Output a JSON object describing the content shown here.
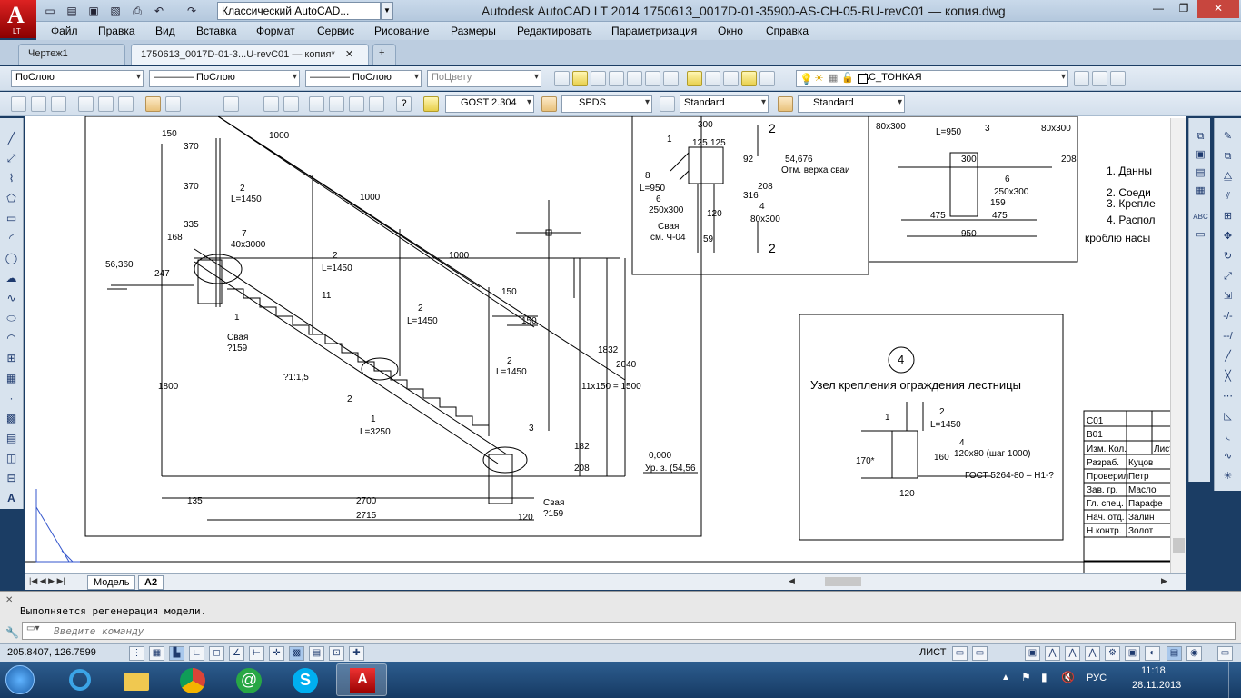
{
  "app": {
    "logo_letter": "A",
    "logo_sub": "LT",
    "workspace": "Классический AutoCAD...",
    "window_title": "Autodesk AutoCAD LT 2014    1750613_0017D-01-35900-AS-CH-05-RU-revC01 — копия.dwg"
  },
  "window_controls": {
    "minimize": "—",
    "restore": "❐",
    "close": "✕"
  },
  "menu": [
    "Файл",
    "Правка",
    "Вид",
    "Вставка",
    "Формат",
    "Сервис",
    "Рисование",
    "Размеры",
    "Редактировать",
    "Параметризация",
    "Окно",
    "Справка"
  ],
  "tabs": {
    "tab1": "Чертеж1",
    "tab2": "1750613_0017D-01-3...U-revC01 — копия*",
    "close": "✕",
    "add": "+"
  },
  "props_toolbar": {
    "color": "ПоСлою",
    "linetype": "———— ПоСлою",
    "lineweight": "———— ПоСлою",
    "plotstyle": "ПоЦвету",
    "layer": "АС_ТОНКАЯ"
  },
  "styles_toolbar": {
    "text_style": "GOST 2.304",
    "dim_style": "SPDS",
    "table_style": "Standard",
    "mleader_style": "Standard"
  },
  "drawing": {
    "dims": [
      "150",
      "370",
      "370",
      "335",
      "168",
      "247",
      "1000",
      "1000",
      "1000",
      "2",
      "L=1450",
      "7",
      "40x3000",
      "56,360",
      "2",
      "L=1450",
      "11",
      "1",
      "Свая",
      "?159",
      "2",
      "L=1450",
      "150",
      "150",
      "2",
      "L=1450",
      "1800",
      "?1:1,5",
      "2",
      "1",
      "L=3250",
      "3",
      "11x150 = 1500",
      "1832",
      "2040",
      "182",
      "208",
      "0,000",
      "Ур. з. (54,56",
      "135",
      "2700",
      "2715",
      "Свая",
      "?159",
      "120"
    ],
    "detail": {
      "labels": [
        "300",
        "125",
        "125",
        "2",
        "1",
        "54,676",
        "Отм. верха сваи",
        "8",
        "L=950",
        "6",
        "250x300",
        "92",
        "208",
        "316",
        "120",
        "59",
        "4",
        "80x300",
        "Свая",
        "см. Ч-04",
        "2"
      ]
    },
    "detail2": {
      "labels": [
        "80x300",
        "3",
        "L=950",
        "80x300",
        "300",
        "208",
        "6",
        "250x300",
        "159",
        "475",
        "475",
        "950"
      ]
    },
    "notes": [
      "1.  Данны",
      "2.  Соеди",
      "3.  Крепле",
      "4.  Распол",
      "кроблю насы"
    ],
    "node4": {
      "number": "4",
      "title": "Узел крепления ограждения лестницы",
      "labels": [
        "1",
        "2",
        "L=1450",
        "4",
        "120x80 (шаг 1000)",
        "170*",
        "160",
        "ГОСТ 5264-80 – Н1-?",
        "120"
      ]
    },
    "stamp": {
      "rows": [
        "С01",
        "В01",
        "Изм. Кол.",
        "Разраб.",
        "Проверил",
        "Зав. гр.",
        "Гл. спец.",
        "Нач. отд.",
        "Н.контр."
      ],
      "names": [
        "Лист",
        "Куцов",
        "Петр",
        "Масло",
        "Парафе",
        "Залин",
        "Золот"
      ]
    }
  },
  "layout_tabs": {
    "model": "Модель",
    "sheet": "А2"
  },
  "command": {
    "history": "Выполняется регенерация модели.",
    "placeholder": "Введите команду"
  },
  "status": {
    "coords": "205.8407, 126.7599",
    "space": "ЛИСТ"
  },
  "taskbar": {
    "lang": "РУС",
    "time": "11:18",
    "date": "28.11.2013"
  }
}
